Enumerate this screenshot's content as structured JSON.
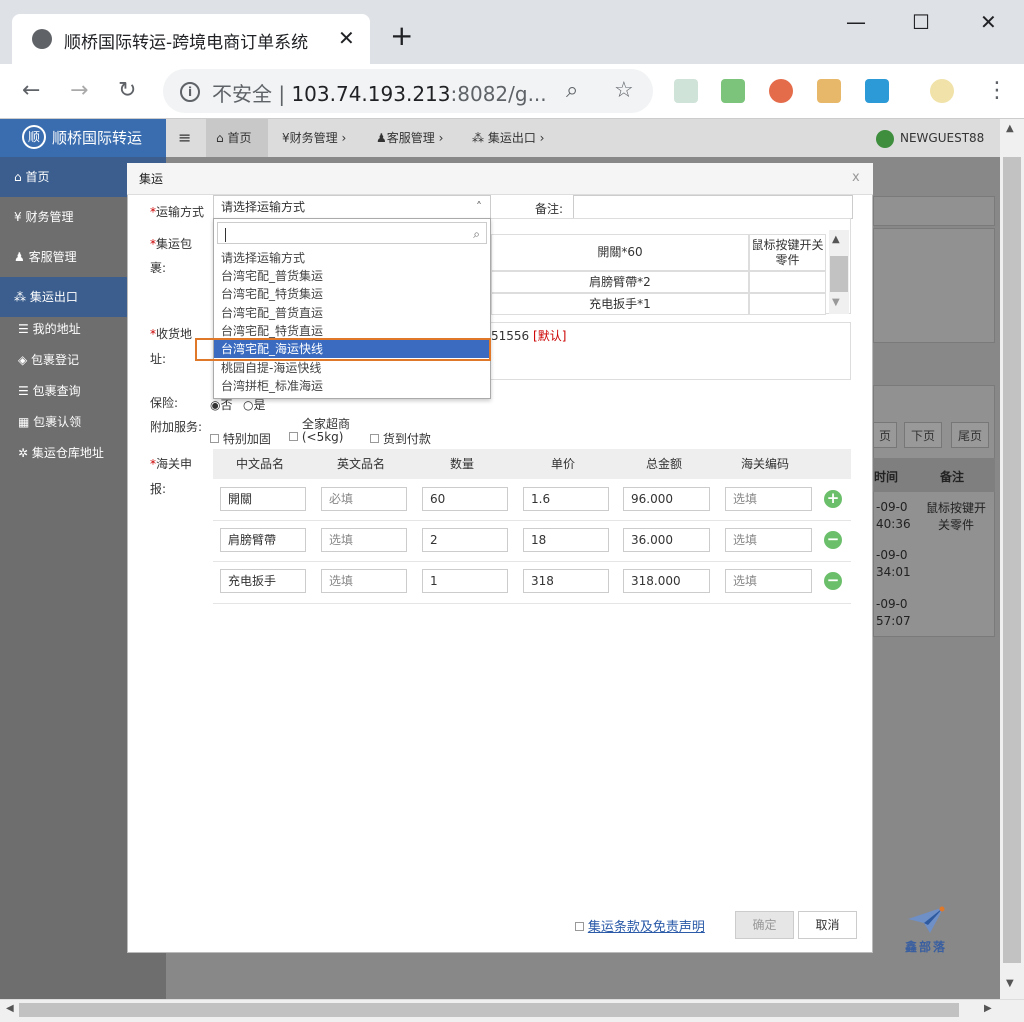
{
  "browser": {
    "tab_title": "顺桥国际转运-跨境电商订单系统",
    "tab_close": "✕",
    "new_tab": "+",
    "insecure_label": "不安全",
    "url_host": "103.74.193.213",
    "url_rest": ":8082/g...",
    "win_min": "—",
    "win_max": "☐",
    "win_close": "✕"
  },
  "app": {
    "brand": "顺桥国际转运",
    "menu_toggle": "≡",
    "nav": [
      {
        "label": "首页",
        "icon": "home-icon"
      },
      {
        "label": "¥财务管理 ›"
      },
      {
        "label": "客服管理 ›"
      },
      {
        "label": "集运出口 ›"
      }
    ],
    "user": "NEWGUEST88",
    "sidebar": {
      "home": "首页",
      "finance": "财务管理",
      "service": "客服管理",
      "export": "集运出口",
      "sub": [
        "我的地址",
        "包裹登记",
        "包裹查询",
        "包裹认领",
        "集运仓库地址"
      ]
    },
    "background": {
      "pager": [
        "页",
        "下页",
        "尾页"
      ],
      "col_time": "时间",
      "col_note": "备注",
      "rows": [
        {
          "date": "-09-0",
          "time": "40:36",
          "note": "鼠标按键开关零件"
        },
        {
          "date": "-09-0",
          "time": "34:01",
          "note": ""
        },
        {
          "date": "-09-0",
          "time": "57:07",
          "note": ""
        }
      ]
    }
  },
  "modal": {
    "title": "集运",
    "close": "x",
    "shipping_label": "运输方式",
    "shipping_placeholder": "请选择运输方式",
    "remark_label": "备注:",
    "parcel_label": "集运包裹:",
    "parcel_rows": [
      {
        "name": "開關*60",
        "note": "鼠标按键开关零件"
      },
      {
        "name": "肩膀臂帶*2",
        "note": ""
      },
      {
        "name": "充电扳手*1",
        "note": ""
      }
    ],
    "address_label": "收货地址:",
    "address_tail": "51556",
    "address_default": "[默认]",
    "insurance_label": "保险:",
    "insurance_options": [
      "否",
      "是"
    ],
    "extra_label": "附加服务:",
    "extra_options": [
      "特别加固",
      "全家超商(<5kg)",
      "货到付款"
    ],
    "extra_familymart_top": "全家超商",
    "extra_familymart_bottom": "(<5kg)",
    "customs_label": "海关申报:",
    "customs_headers": [
      "中文品名",
      "英文品名",
      "数量",
      "单价",
      "总金额",
      "海关编码"
    ],
    "customs_rows": [
      {
        "cn": "開關",
        "en": "必填",
        "qty": "60",
        "price": "1.6",
        "total": "96.000",
        "code": "选填",
        "action": "+"
      },
      {
        "cn": "肩膀臂帶",
        "en": "选填",
        "qty": "2",
        "price": "18",
        "total": "36.000",
        "code": "选填",
        "action": "−"
      },
      {
        "cn": "充电扳手",
        "en": "选填",
        "qty": "1",
        "price": "318",
        "total": "318.000",
        "code": "选填",
        "action": "−"
      }
    ],
    "terms_link": "集运条款及免责声明",
    "confirm": "确定",
    "cancel": "取消"
  },
  "dropdown": {
    "options": [
      "请选择运输方式",
      "台湾宅配_普货集运",
      "台湾宅配_特货集运",
      "台湾宅配_普货直运",
      "台湾宅配_特货直运",
      "台湾宅配_海运快线",
      "桃园自提-海运快线",
      "台湾拼柜_标准海运"
    ],
    "selected_index": 5
  },
  "watermark": "鑫部落",
  "colors": {
    "accent": "#3a6daf",
    "highlight": "#e0782a",
    "selected": "#3a6bc0",
    "add": "#6bbf6b"
  }
}
